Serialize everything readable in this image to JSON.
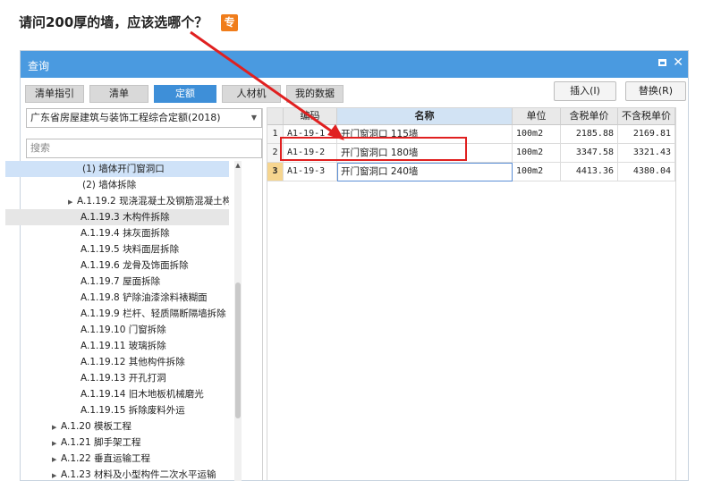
{
  "question": {
    "text": "请问200厚的墙，应该选哪个？",
    "badge": "专"
  },
  "window": {
    "title": "查询",
    "maximize_glyph": "",
    "close_glyph": "✕"
  },
  "tabs": [
    {
      "label": "清单指引",
      "active": false
    },
    {
      "label": "清单",
      "active": false
    },
    {
      "label": "定额",
      "active": true
    },
    {
      "label": "人材机",
      "active": false
    },
    {
      "label": "我的数据",
      "active": false
    }
  ],
  "buttons": {
    "insert": "插入(I)",
    "replace": "替换(R)"
  },
  "left": {
    "library": "广东省房屋建筑与装饰工程综合定额(2018)",
    "search_placeholder": "搜索"
  },
  "tree": [
    {
      "label": "(1) 墙体开门窗洞口",
      "state": "selected",
      "expand": ""
    },
    {
      "label": "(2) 墙体拆除",
      "state": "",
      "expand": ""
    },
    {
      "label": "A.1.19.2 现浇混凝土及钢筋混凝土构...",
      "state": "",
      "expand": "▶"
    },
    {
      "label": "A.1.19.3 木构件拆除",
      "state": "hover",
      "expand": ""
    },
    {
      "label": "A.1.19.4 抹灰面拆除",
      "state": "",
      "expand": ""
    },
    {
      "label": "A.1.19.5 块料面层拆除",
      "state": "",
      "expand": ""
    },
    {
      "label": "A.1.19.6 龙骨及饰面拆除",
      "state": "",
      "expand": ""
    },
    {
      "label": "A.1.19.7 屋面拆除",
      "state": "",
      "expand": ""
    },
    {
      "label": "A.1.19.8 铲除油漆涂料裱糊面",
      "state": "",
      "expand": ""
    },
    {
      "label": "A.1.19.9 栏杆、轻质隔断隔墙拆除",
      "state": "",
      "expand": ""
    },
    {
      "label": "A.1.19.10 门窗拆除",
      "state": "",
      "expand": ""
    },
    {
      "label": "A.1.19.11 玻璃拆除",
      "state": "",
      "expand": ""
    },
    {
      "label": "A.1.19.12 其他构件拆除",
      "state": "",
      "expand": ""
    },
    {
      "label": "A.1.19.13 开孔打洞",
      "state": "",
      "expand": ""
    },
    {
      "label": "A.1.19.14 旧木地板机械磨光",
      "state": "",
      "expand": ""
    },
    {
      "label": "A.1.19.15 拆除废料外运",
      "state": "",
      "expand": ""
    },
    {
      "label": "A.1.20 模板工程",
      "state": "",
      "expand": "▶"
    },
    {
      "label": "A.1.21 脚手架工程",
      "state": "",
      "expand": "▶"
    },
    {
      "label": "A.1.22 垂直运输工程",
      "state": "",
      "expand": "▶"
    },
    {
      "label": "A.1.23 材料及小型构件二次水平运输",
      "state": "",
      "expand": "▶"
    }
  ],
  "grid": {
    "headers": [
      "",
      "编码",
      "名称",
      "单位",
      "含税单价",
      "不含税单价"
    ],
    "rows": [
      {
        "idx": "1",
        "code": "A1-19-1",
        "name": "开门窗洞口 115墙",
        "unit": "100m2",
        "price_tax": "2185.88",
        "price_notax": "2169.81",
        "current": false
      },
      {
        "idx": "2",
        "code": "A1-19-2",
        "name": "开门窗洞口 180墙",
        "unit": "100m2",
        "price_tax": "3347.58",
        "price_notax": "3321.43",
        "current": false
      },
      {
        "idx": "3",
        "code": "A1-19-3",
        "name": "开门窗洞口 240墙",
        "unit": "100m2",
        "price_tax": "4413.36",
        "price_notax": "4380.04",
        "current": true
      }
    ]
  },
  "annotation": {
    "color": "#e02020"
  }
}
